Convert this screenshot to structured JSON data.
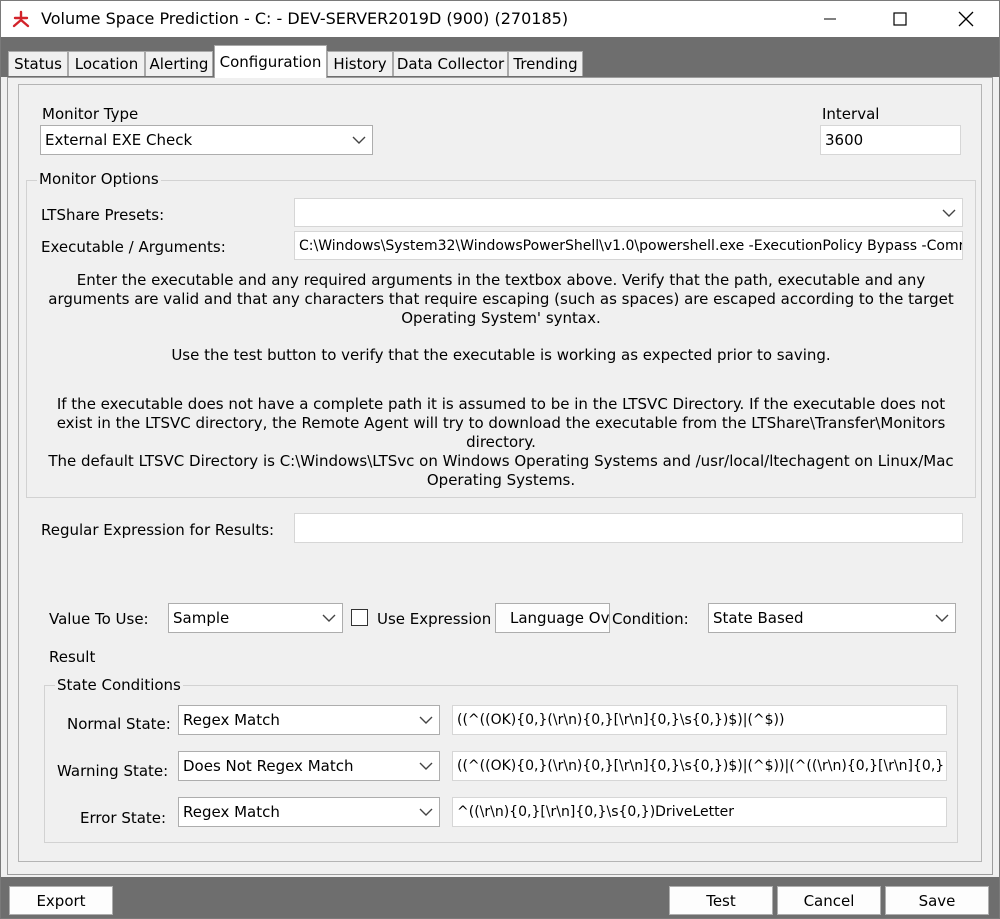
{
  "window": {
    "title": "Volume Space Prediction - C: - DEV-SERVER2019D (900) (270185)",
    "minimize_icon": "minimize-icon",
    "maximize_icon": "maximize-icon",
    "close_icon": "close-icon"
  },
  "tabs": [
    {
      "label": "Status"
    },
    {
      "label": "Location"
    },
    {
      "label": "Alerting"
    },
    {
      "label": "Configuration",
      "active": true
    },
    {
      "label": "History"
    },
    {
      "label": "Data Collector"
    },
    {
      "label": "Trending"
    }
  ],
  "config": {
    "monitor_type_label": "Monitor Type",
    "monitor_type_value": "External EXE Check",
    "interval_label": "Interval",
    "interval_value": "3600",
    "monitor_options_label": "Monitor Options",
    "ltshare_presets_label": "LTShare Presets:",
    "ltshare_presets_value": "",
    "executable_label": "Executable / Arguments:",
    "executable_value": "C:\\Windows\\System32\\WindowsPowerShell\\v1.0\\powershell.exe -ExecutionPolicy Bypass -Comr",
    "help_text_1": "Enter the executable and any required arguments in the textbox above. Verify that the path, executable and any arguments are valid and that any characters that require escaping (such as spaces) are escaped according to the target Operating System' syntax.",
    "help_text_2": "Use the test button to verify that the executable is working as expected prior to saving.",
    "help_text_3": "If the executable does not have a complete path it is assumed to be in the LTSVC Directory. If the executable does not exist in the LTSVC directory, the Remote Agent will try to download the executable from the LTShare\\Transfer\\Monitors directory.",
    "help_text_4": "The default LTSVC Directory is C:\\Windows\\LTSvc on Windows Operating Systems and /usr/local/ltechagent on Linux/Mac Operating Systems.",
    "regex_label": "Regular Expression for Results:",
    "regex_value": "",
    "value_to_use_label": "Value To Use:",
    "value_to_use_value": "Sample",
    "use_expression_label": "Use Expression",
    "use_expression_checked": false,
    "language_override_label": "Language Ove",
    "condition_label": "Condition:",
    "condition_value": "State Based",
    "result_label": "Result",
    "state_conditions_label": "State Conditions",
    "normal_state_label": "Normal State:",
    "normal_state_mode": "Regex Match",
    "normal_state_expr": "((^((OK){0,}(\\r\\n){0,}[\\r\\n]{0,}\\s{0,})$)|(^$))",
    "warning_state_label": "Warning State:",
    "warning_state_mode": "Does Not Regex Match",
    "warning_state_expr": "((^((OK){0,}(\\r\\n){0,}[\\r\\n]{0,}\\s{0,})$)|(^$))|(^((\\r\\n){0,}[\\r\\n]{0,}",
    "error_state_label": "Error State:",
    "error_state_mode": "Regex Match",
    "error_state_expr": "^((\\r\\n){0,}[\\r\\n]{0,}\\s{0,})DriveLetter"
  },
  "footer": {
    "export_label": "Export",
    "test_label": "Test",
    "cancel_label": "Cancel",
    "save_label": "Save"
  },
  "colors": {
    "chrome_bg": "#f0f0f0",
    "tabstrip_bg": "#6e6e6e",
    "app_icon_red": "#d2232a"
  }
}
